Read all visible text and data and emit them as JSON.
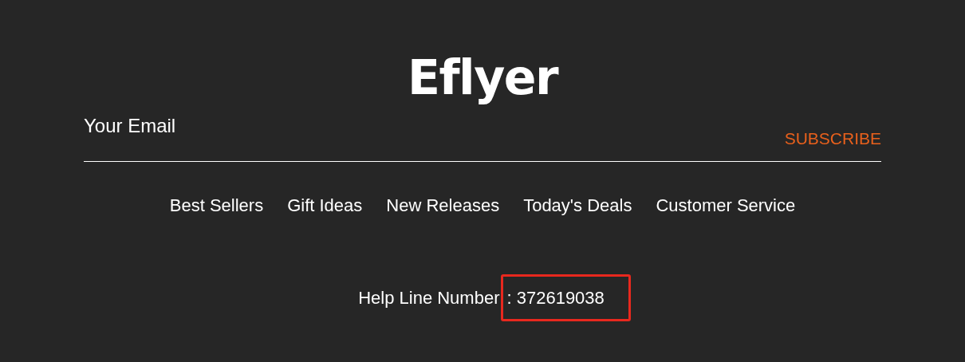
{
  "logo": "Eflyer",
  "newsletter": {
    "placeholder": "Your Email",
    "button": "SUBSCRIBE"
  },
  "nav": [
    "Best Sellers",
    "Gift Ideas",
    "New Releases",
    "Today's Deals",
    "Customer Service"
  ],
  "help_line": {
    "label": "Help Line Number",
    "number": ": 372619038",
    "highlighted": true
  }
}
